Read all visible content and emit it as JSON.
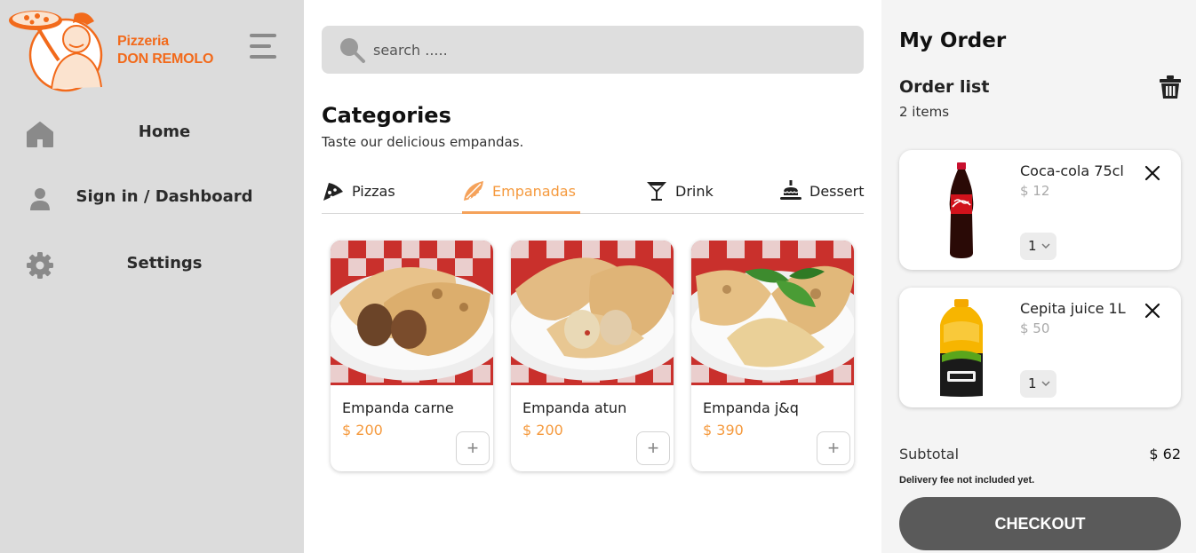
{
  "brand": {
    "line1": "Pizzeria",
    "line2": "DON REMOLO",
    "color": "#f26a1b"
  },
  "sidebar": {
    "items": [
      {
        "label": "Home",
        "icon": "home-icon"
      },
      {
        "label": "Sign in / Dashboard",
        "icon": "user-icon"
      },
      {
        "label": "Settings",
        "icon": "gear-icon"
      }
    ]
  },
  "search": {
    "placeholder": "search .....",
    "value": ""
  },
  "categories": {
    "title": "Categories",
    "subtitle": "Taste our delicious empandas.",
    "tabs": [
      {
        "label": "Pizzas",
        "icon": "pizza-slice-icon",
        "active": false
      },
      {
        "label": "Empanadas",
        "icon": "empanada-icon",
        "active": true
      },
      {
        "label": "Drink",
        "icon": "cocktail-glass-icon",
        "active": false
      },
      {
        "label": "Dessert",
        "icon": "cake-icon",
        "active": false
      }
    ]
  },
  "products": [
    {
      "name": "Empanda carne",
      "price": "$ 200",
      "add": "+"
    },
    {
      "name": "Empanda atun",
      "price": "$ 200",
      "add": "+"
    },
    {
      "name": "Empanda j&q",
      "price": "$ 390",
      "add": "+"
    }
  ],
  "order": {
    "title": "My Order",
    "list_title": "Order list",
    "count": "2 items",
    "items": [
      {
        "name": "Coca-cola 75cl",
        "price": "$ 12",
        "qty": "1"
      },
      {
        "name": "Cepita juice 1L",
        "price": "$ 50",
        "qty": "1"
      }
    ],
    "subtotal_label": "Subtotal",
    "subtotal_value": "$ 62",
    "delivery_note": "Delivery fee not included yet.",
    "checkout_label": "CHECKOUT"
  },
  "colors": {
    "accent": "#f59a3e",
    "sidebar_bg": "#dcdcdc",
    "checkout_bg": "#5a5a5a",
    "order_bg": "#f4f4f4"
  }
}
